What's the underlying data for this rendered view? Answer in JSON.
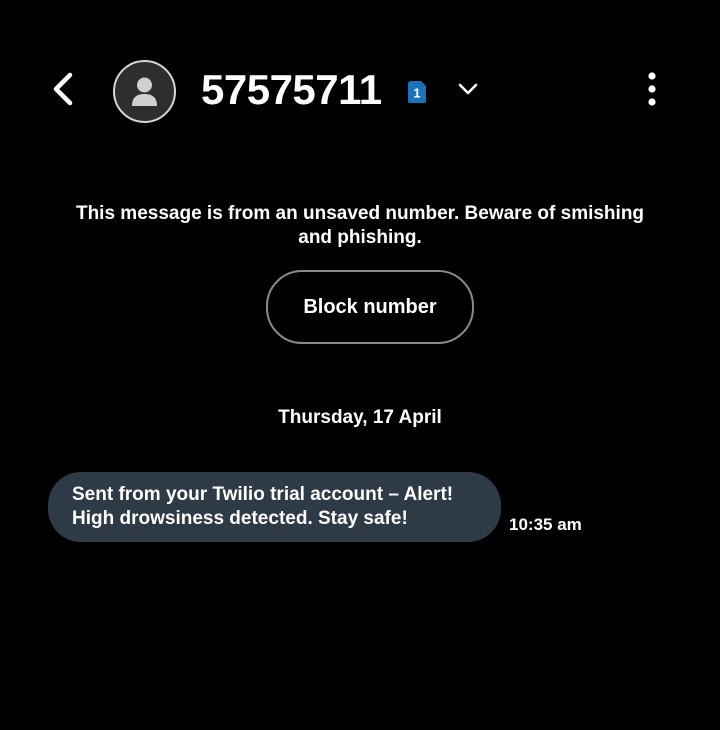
{
  "header": {
    "contact_number": "57575711",
    "sim_badge": "1",
    "icons": {
      "back": "back-arrow-icon",
      "avatar": "person-icon",
      "sim": "sim-card-icon",
      "expand": "chevron-down-icon",
      "more": "more-vertical-icon"
    }
  },
  "warning": {
    "text": "This message is from an unsaved number. Beware of smishing and phishing."
  },
  "actions": {
    "block_label": "Block number"
  },
  "conversation": {
    "date_separator": "Thursday, 17 April",
    "messages": [
      {
        "lines": [
          "Sent from your Twilio trial account – Alert!",
          "High drowsiness detected. Stay safe!"
        ],
        "time": "10:35 am"
      }
    ]
  },
  "colors": {
    "background": "#000000",
    "bubble": "#2f3a47",
    "sim_badge": "#1a73b8",
    "button_border": "#8a8a8a"
  }
}
